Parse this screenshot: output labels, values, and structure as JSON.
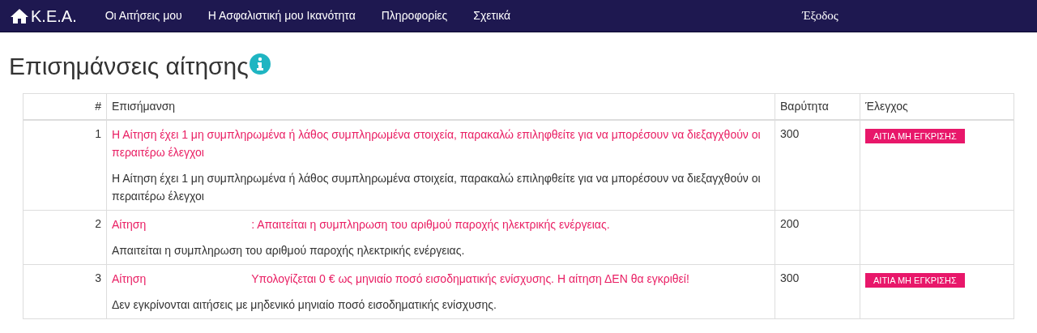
{
  "navbar": {
    "brand": "K.E.A.",
    "items": [
      {
        "label": "Οι Αιτήσεις μου"
      },
      {
        "label": "Η Ασφαλιστική μου Ικανότητα"
      },
      {
        "label": "Πληροφορίες"
      },
      {
        "label": "Σχετικά"
      }
    ],
    "logout": "Έξοδος"
  },
  "title": "Επισημάνσεις αίτησης",
  "table": {
    "columns": [
      "#",
      "Επισήμανση",
      "Βαρύτητα",
      "Έλεγχος"
    ],
    "rows": [
      {
        "number": "1",
        "prefix": "",
        "message": "Η Αίτηση έχει 1 μη συμπληρωμένα ή λάθος συμπληρωμένα στοιχεία, παρακαλώ επιληφθείτε για να μπορέσουν να διεξαγχθούν οι περαιτέρω έλεγχοι",
        "detail": "Η Αίτηση έχει 1 μη συμπληρωμένα ή λάθος συμπληρωμένα στοιχεία, παρακαλώ επιληφθείτε για να μπορέσουν να διεξαγχθούν οι περαιτέρω έλεγχοι",
        "severity": "300",
        "control": "ΑΙΤΙΑ ΜΗ ΕΓΚΡΙΣΗΣ"
      },
      {
        "number": "2",
        "prefix": "Αίτηση",
        "message": ": Απαιτείται η συμπληρωση του αριθμού παροχής ηλεκτρικής ενέργειας.",
        "detail": "Απαιτείται η συμπληρωση του αριθμού παροχής ηλεκτρικής ενέργειας.",
        "severity": "200",
        "control": ""
      },
      {
        "number": "3",
        "prefix": "Αίτηση",
        "message": "Υπολογίζεται 0 € ως μηνιαίο ποσό εισοδηματικής ενίσχυσης. Η αίτηση ΔΕΝ θα εγκριθεί!",
        "detail": "Δεν εγκρίνονται αιτήσεις με μηδενικό μηνιαίο ποσό εισοδηματικής ενίσχυσης.",
        "severity": "300",
        "control": "ΑΙΤΙΑ ΜΗ ΕΓΚΡΙΣΗΣ"
      }
    ]
  }
}
